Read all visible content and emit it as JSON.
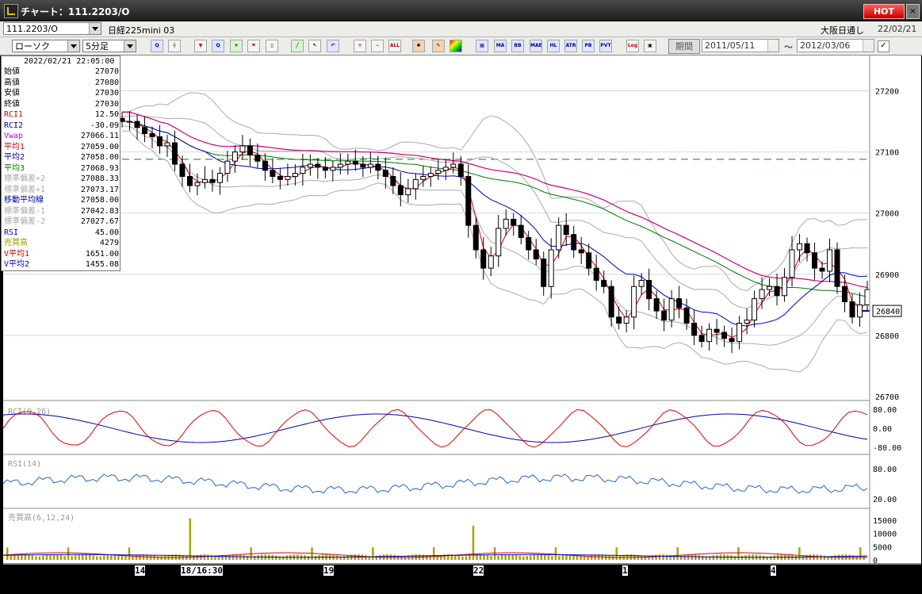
{
  "window": {
    "title": "チャート：111.2203/O",
    "hot": "HOT",
    "close": "×"
  },
  "symbol": {
    "code": "111.2203/O",
    "name": "日経225mini 03",
    "session": "大阪日通し",
    "date": "22/02/21"
  },
  "toolbar": {
    "chart_type": "ローソク",
    "interval": "5分足",
    "period_label": "期間",
    "from_date": "2011/05/11",
    "to_date": "2012/03/06",
    "tilde": "～",
    "icons": [
      {
        "name": "zoom-icon",
        "t": "Q",
        "c": "blue"
      },
      {
        "name": "crosshair-icon",
        "t": "┼",
        "c": ""
      },
      {
        "name": "stamp-icon",
        "t": "▼",
        "c": "red"
      },
      {
        "name": "magnifier-icon",
        "t": "Q",
        "c": "blue"
      },
      {
        "name": "chart-add-icon",
        "t": "+",
        "c": "grn"
      },
      {
        "name": "flag-icon",
        "t": "⚑",
        "c": "red"
      },
      {
        "name": "trash-icon",
        "t": "▯",
        "c": ""
      },
      {
        "name": "draw-line-icon",
        "t": "╱",
        "c": "grn"
      },
      {
        "name": "cursor-icon",
        "t": "↖",
        "c": ""
      },
      {
        "name": "undo-icon",
        "t": "↶",
        "c": "blue"
      },
      {
        "name": "zoom-in-icon",
        "t": "+",
        "c": "red"
      },
      {
        "name": "zoom-out-icon",
        "t": "−",
        "c": "red"
      },
      {
        "name": "all-icon",
        "t": "ALL",
        "c": "red"
      },
      {
        "name": "settings-icon",
        "t": "✱",
        "c": "ora"
      },
      {
        "name": "tools-icon",
        "t": "✎",
        "c": "ora"
      },
      {
        "name": "palette-icon",
        "t": "",
        "c": "rain"
      },
      {
        "name": "grid-icon",
        "t": "▦",
        "c": "blue"
      },
      {
        "name": "ma-icon",
        "t": "MA",
        "c": "blue"
      },
      {
        "name": "bb-icon",
        "t": "BB",
        "c": "blue"
      },
      {
        "name": "mae-icon",
        "t": "MAE",
        "c": "blue"
      },
      {
        "name": "hl-icon",
        "t": "HL",
        "c": "blue"
      },
      {
        "name": "atr-icon",
        "t": "ATR",
        "c": "blue"
      },
      {
        "name": "pb-icon",
        "t": "PB",
        "c": "blue"
      },
      {
        "name": "pvt-icon",
        "t": "PVT",
        "c": "blue"
      },
      {
        "name": "log-icon",
        "t": "Log",
        "c": "red"
      },
      {
        "name": "export-icon",
        "t": "▣",
        "c": ""
      }
    ]
  },
  "info_panel": {
    "timestamp": "2022/02/21  22:05:00",
    "rows": [
      {
        "k": "始値",
        "v": "27070",
        "c": "#000000"
      },
      {
        "k": "高値",
        "v": "27080",
        "c": "#000000"
      },
      {
        "k": "安値",
        "v": "27030",
        "c": "#000000"
      },
      {
        "k": "終値",
        "v": "27030",
        "c": "#000000"
      },
      {
        "k": "RCI1",
        "v": "12.50",
        "c": "#cc0000"
      },
      {
        "k": "RCI2",
        "v": "-30.09",
        "c": "#000099"
      },
      {
        "k": "Vwap",
        "v": "27066.11",
        "c": "#cc00cc"
      },
      {
        "k": "平均1",
        "v": "27059.00",
        "c": "#cc0000"
      },
      {
        "k": "平均2",
        "v": "27058.00",
        "c": "#000099"
      },
      {
        "k": "平均3",
        "v": "27068.93",
        "c": "#007700"
      },
      {
        "k": "標準偏差+2",
        "v": "27088.33",
        "c": "#aaaaaa"
      },
      {
        "k": "標準偏差+1",
        "v": "27073.17",
        "c": "#aaaaaa"
      },
      {
        "k": "移動平均線",
        "v": "27058.00",
        "c": "#000099"
      },
      {
        "k": "標準偏差-1",
        "v": "27042.83",
        "c": "#aaaaaa"
      },
      {
        "k": "標準偏差-2",
        "v": "27027.67",
        "c": "#aaaaaa"
      },
      {
        "k": "RSI",
        "v": "45.00",
        "c": "#0000cc"
      },
      {
        "k": "売買高",
        "v": "4279",
        "c": "#999900"
      },
      {
        "k": "V平均1",
        "v": "1651.00",
        "c": "#cc0000"
      },
      {
        "k": "V平均2",
        "v": "1455.08",
        "c": "#0000cc"
      }
    ]
  },
  "chart_data": [
    {
      "type": "candlestick",
      "ylim": [
        26700,
        27250
      ],
      "yticks": [
        "27200",
        "27100",
        "27000",
        "26900",
        "26800",
        "26700"
      ],
      "x_labels": [
        "14",
        "18/16:30",
        "19",
        "22",
        "1",
        "4"
      ],
      "current_price": "26840",
      "closes": [
        27150,
        27150,
        27140,
        27130,
        27125,
        27110,
        27115,
        27080,
        27060,
        27045,
        27050,
        27055,
        27050,
        27065,
        27085,
        27100,
        27110,
        27095,
        27085,
        27070,
        27060,
        27055,
        27060,
        27065,
        27075,
        27080,
        27075,
        27070,
        27075,
        27080,
        27085,
        27080,
        27075,
        27080,
        27070,
        27060,
        27045,
        27030,
        27040,
        27055,
        27060,
        27065,
        27070,
        27075,
        27080,
        27060,
        26980,
        26940,
        26910,
        26930,
        26975,
        26990,
        26980,
        26960,
        26940,
        26925,
        26880,
        26940,
        26980,
        26965,
        26940,
        26935,
        26910,
        26890,
        26880,
        26830,
        26820,
        26830,
        26880,
        26890,
        26860,
        26840,
        26825,
        26860,
        26845,
        26820,
        26800,
        26790,
        26810,
        26805,
        26795,
        26790,
        26820,
        26825,
        26860,
        26875,
        26880,
        26865,
        26895,
        26940,
        26950,
        26935,
        26910,
        26905,
        26940,
        26880,
        26855,
        26830,
        26850,
        26875
      ]
    },
    {
      "type": "line",
      "title": "RCI(9,26)",
      "ylim": [
        -100,
        100
      ],
      "yticks": [
        "80.00",
        "0.00",
        "-80.00"
      ]
    },
    {
      "type": "line",
      "title": "RSI(14)",
      "ylim": [
        0,
        100
      ],
      "yticks": [
        "80.00",
        "20.00"
      ]
    },
    {
      "type": "bar",
      "title": "売買高(6,12,24)",
      "ylim": [
        0,
        18000
      ],
      "yticks": [
        "15000",
        "10000",
        "5000",
        "0"
      ]
    }
  ]
}
